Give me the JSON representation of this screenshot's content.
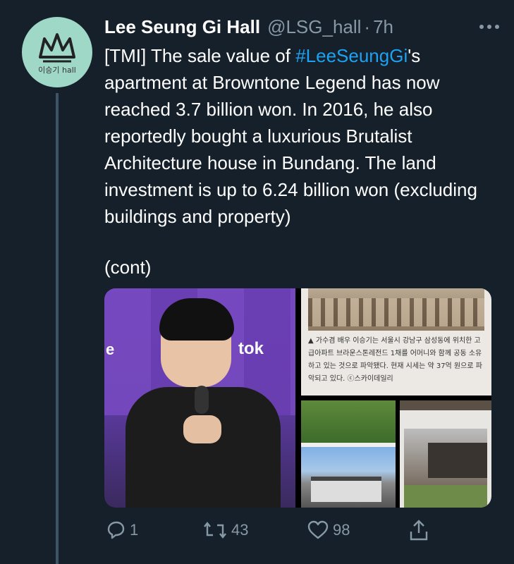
{
  "tweet": {
    "display_name": "Lee Seung Gi Hall",
    "handle": "@LSG_hall",
    "separator": "·",
    "time": "7h",
    "text_before": "[TMI] The sale value of ",
    "hashtag": "#LeeSeungGi",
    "text_after": "'s apartment at Browntone Legend has now reached 3.7 billion won. In 2016, he also reportedly bought a luxurious Brutalist Architecture house in Bundang. The land investment is up to 6.24 billion won (excluding buildings and property)",
    "continuation": "(cont)"
  },
  "avatar": {
    "caption": "이승기 hall",
    "icon": "crown-icon"
  },
  "media": {
    "photo_logo_left": "e",
    "photo_logo_right": "tok",
    "news_caption": "▲ 가수겸 배우 이승기는 서울시 강남구 삼성동에 위치한 고급아파트 브라운스톤레전드 1채를 어머니와 함께 공동 소유하고 있는 것으로 파악됐다. 현재 시세는 약 37억 원으로 파악되고 있다. ⓒ스카이데일리"
  },
  "actions": {
    "reply_count": "1",
    "retweet_count": "43",
    "like_count": "98"
  },
  "colors": {
    "background": "#15202b",
    "secondary_text": "#8899a6",
    "link": "#1da1f2",
    "avatar_bg": "#9fd8c6"
  }
}
